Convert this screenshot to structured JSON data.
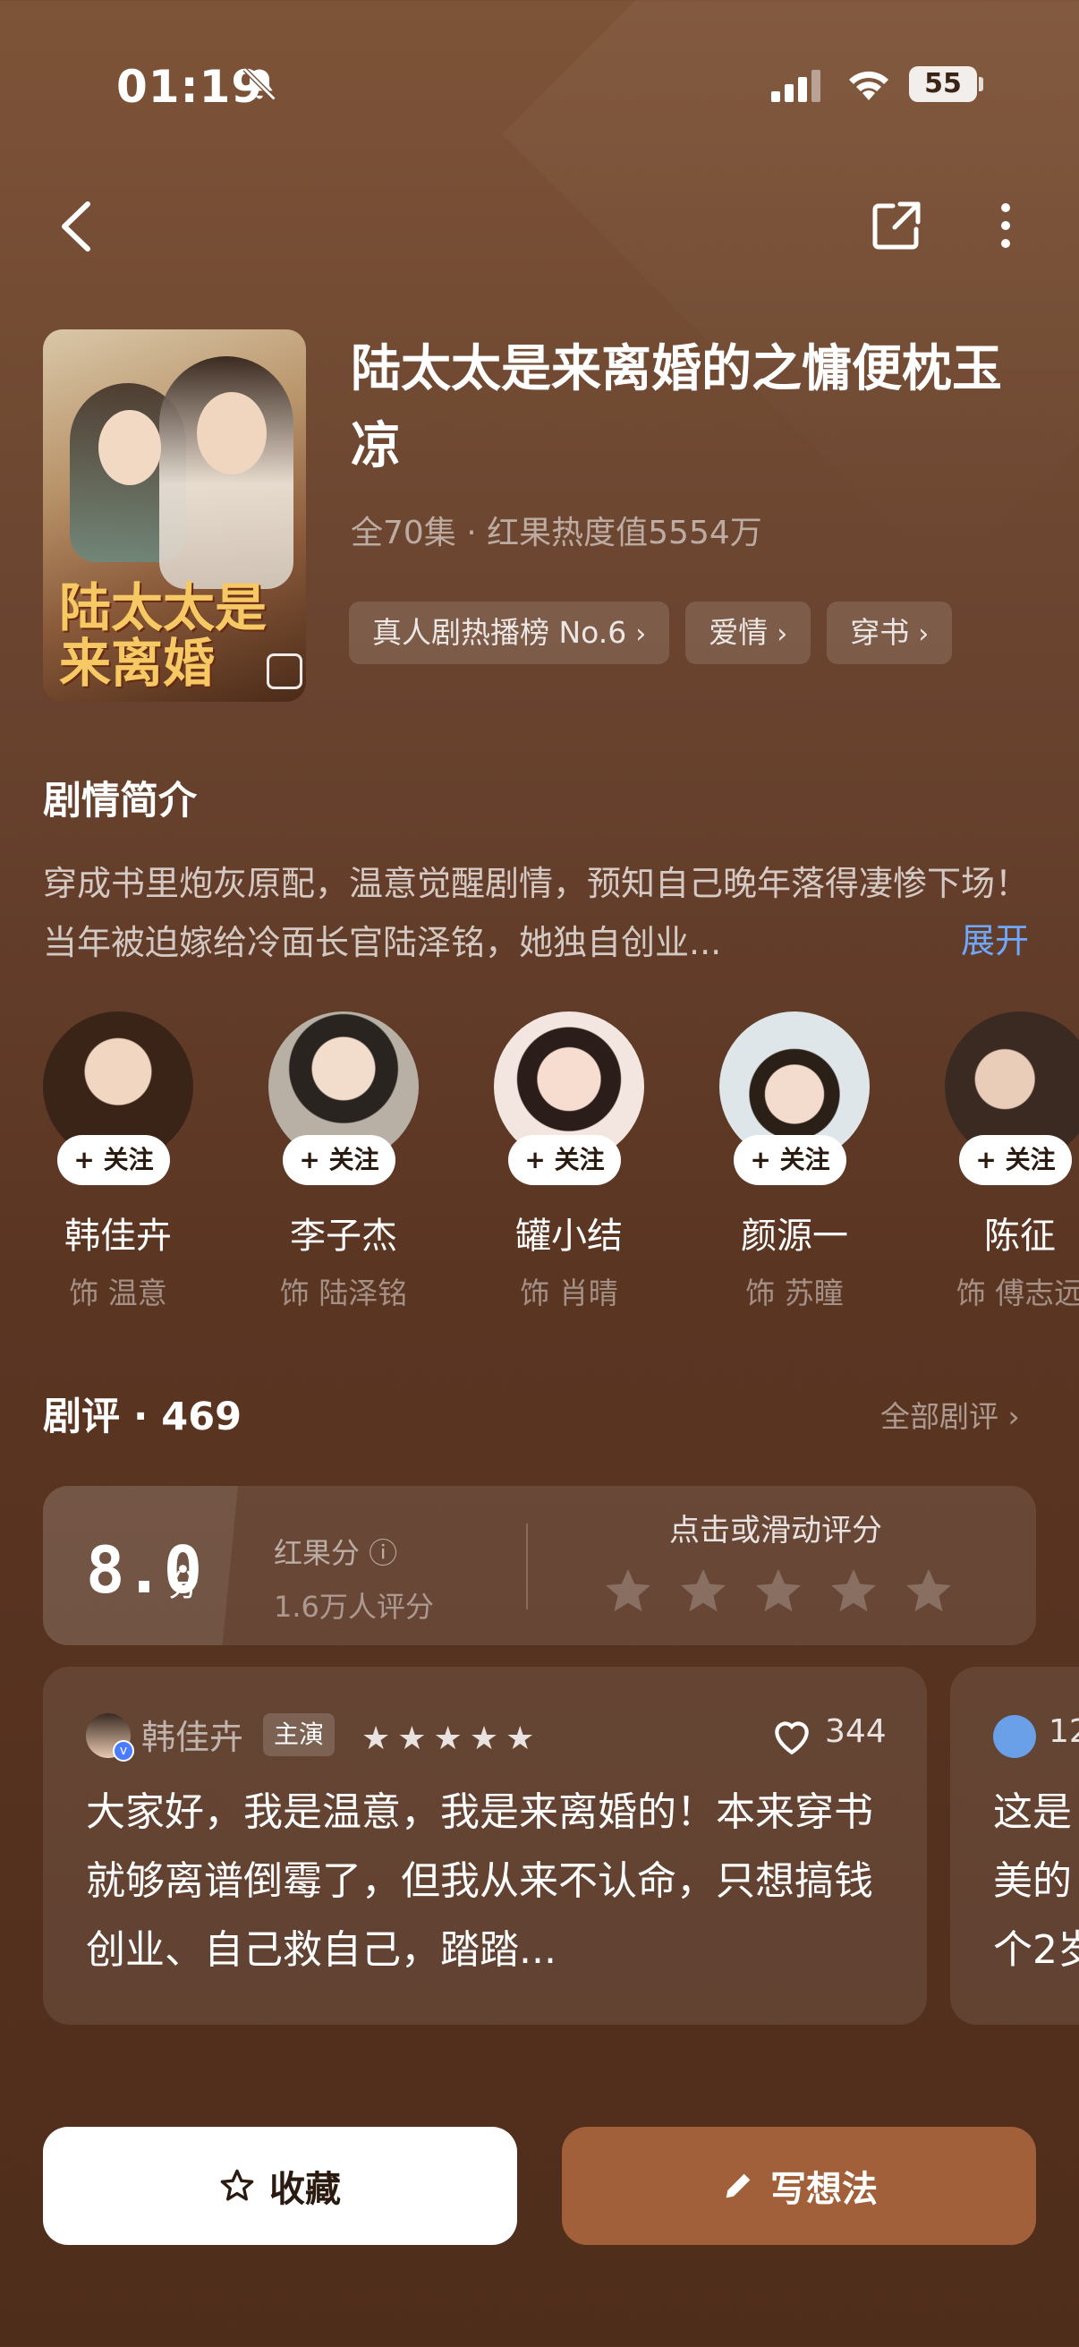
{
  "status_bar": {
    "time": "01:19",
    "battery": "55"
  },
  "show": {
    "title": "陆太太是来离婚的之慵便枕玉凉",
    "meta": "全70集 · 红果热度值5554万",
    "poster_logo": "陆太太是来离婚",
    "tags": [
      {
        "label": "真人剧热播榜 No.6"
      },
      {
        "label": "爱情"
      },
      {
        "label": "穿书"
      }
    ]
  },
  "synopsis": {
    "heading": "剧情简介",
    "text": "穿成书里炮灰原配，温意觉醒剧情，预知自己晚年落得凄惨下场！当年被迫嫁给冷面长官陆泽铭，她独自创业...",
    "expand": "展开"
  },
  "cast": {
    "follow_label": "+ 关注",
    "members": [
      {
        "name": "韩佳卉",
        "role": "饰 温意",
        "color": "#6a4a3a"
      },
      {
        "name": "李子杰",
        "role": "饰 陆泽铭",
        "color": "#c8bfb2"
      },
      {
        "name": "罐小结",
        "role": "饰 肖晴",
        "color": "#f3e3d8"
      },
      {
        "name": "颜源一",
        "role": "饰 苏瞳",
        "color": "#e9ecef"
      },
      {
        "name": "陈征",
        "role": "饰 傅志远",
        "color": "#4b3a30"
      }
    ]
  },
  "reviews": {
    "heading": "剧评 · 469",
    "all_link": "全部剧评 ›",
    "score": "8.0",
    "score_unit": "分",
    "score_label": "红果分 ⓘ",
    "rating_count": "1.6万人评分",
    "rate_prompt": "点击或滑动评分",
    "card": {
      "author": "韩佳卉",
      "role_badge": "主演",
      "stars": "★★★★★",
      "likes": "344",
      "text": "大家好，我是温意，我是来离婚的！本来穿书就够离谱倒霉了，但我从来不认命，只想搞钱创业、自己救自己，踏踏..."
    },
    "card2": {
      "likes_partial": "12",
      "text_lines": [
        "这是",
        "美的",
        "个2岁"
      ]
    }
  },
  "actions": {
    "favorite": "收藏",
    "write": "写想法"
  },
  "colors": {
    "accent_button": "#a2603a",
    "link_blue": "#6fa8ff",
    "bg_top": "#7e5438",
    "bg_bottom": "#4f2d1b"
  }
}
